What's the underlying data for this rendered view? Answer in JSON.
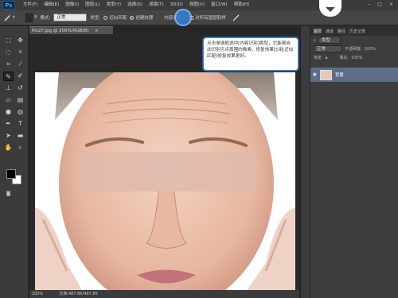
{
  "app": {
    "logo": "Ps"
  },
  "menu": [
    "文件(F)",
    "编辑(E)",
    "图像(I)",
    "图层(L)",
    "类型(Y)",
    "选择(S)",
    "滤镜(T)",
    "3D(D)",
    "视图(V)",
    "窗口(W)",
    "帮助(H)"
  ],
  "window_controls": [
    "–",
    "□",
    "×"
  ],
  "options": {
    "size_label": "9",
    "mode_label": "模式:",
    "mode_value": "正常",
    "type_label": "类型:",
    "opt1": "近似匹配",
    "opt2": "创建纹理",
    "opt3": "内容识别",
    "sample_all": "对所有图层取样"
  },
  "doc": {
    "tab": "Pic27.jpg @ 200%(RGB/8)",
    "close": "×"
  },
  "status": {
    "zoom": "200%",
    "doc": "文档:487.8K/487.8K"
  },
  "tooltip": {
    "text": "点击单选框选中[内容识别]类型，它能够自动识别污点周围的像素，修复效果比用[近似匹配]修复效果更好。"
  },
  "layers": {
    "tabs": [
      "图层",
      "通道",
      "路径",
      "历史记录"
    ],
    "kind": "类型",
    "blend": "正常",
    "opacity_label": "不透明度:",
    "opacity": "100%",
    "lock_label": "锁定:",
    "fill_label": "填充:",
    "fill": "100%",
    "layer_name": "背景"
  }
}
